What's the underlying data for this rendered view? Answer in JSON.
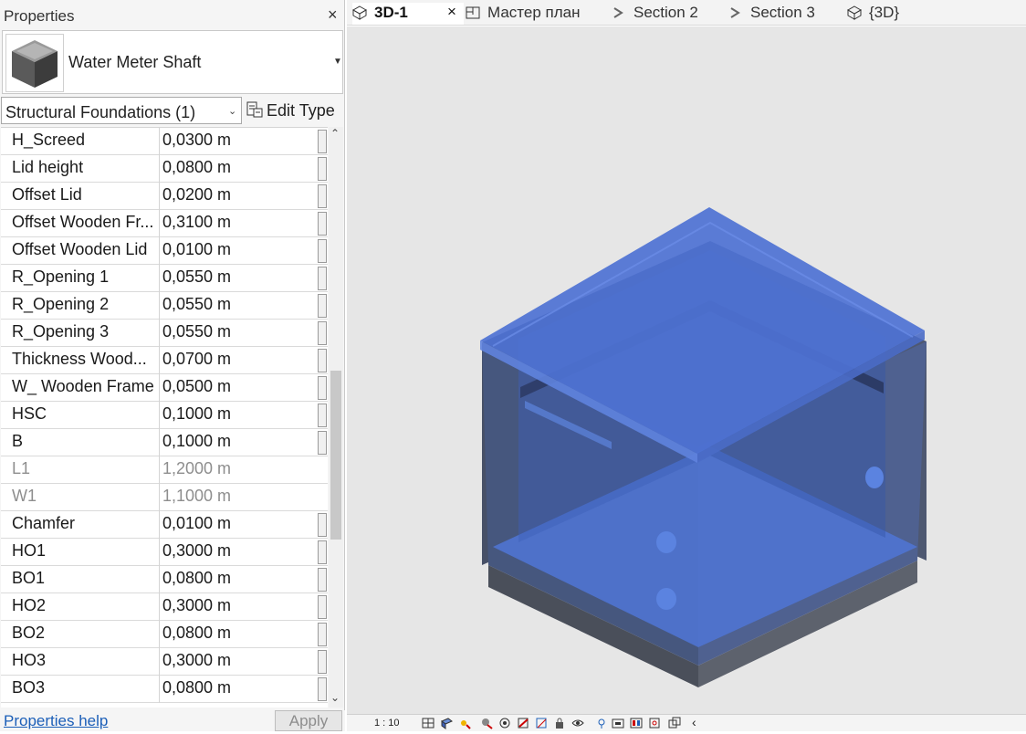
{
  "properties": {
    "title": "Properties",
    "close_glyph": "×",
    "type_name": "Water Meter Shaft",
    "filter_label": "Structural Foundations (1)",
    "edit_type_label": "Edit Type",
    "help_label": "Properties help",
    "apply_label": "Apply",
    "rows": [
      {
        "name": "H_Screed",
        "value": "0,0300 m",
        "dim": false
      },
      {
        "name": "Lid height",
        "value": "0,0800 m",
        "dim": false
      },
      {
        "name": "Offset Lid",
        "value": "0,0200 m",
        "dim": false
      },
      {
        "name": "Offset Wooden Fr...",
        "value": "0,3100 m",
        "dim": false
      },
      {
        "name": "Offset Wooden Lid",
        "value": "0,0100 m",
        "dim": false
      },
      {
        "name": "R_Opening 1",
        "value": "0,0550 m",
        "dim": false
      },
      {
        "name": "R_Opening 2",
        "value": "0,0550 m",
        "dim": false
      },
      {
        "name": "R_Opening 3",
        "value": "0,0550 m",
        "dim": false
      },
      {
        "name": "Thickness  Wood...",
        "value": "0,0700 m",
        "dim": false
      },
      {
        "name": "W_ Wooden Frame",
        "value": "0,0500 m",
        "dim": false
      },
      {
        "name": "HSC",
        "value": "0,1000 m",
        "dim": false
      },
      {
        "name": "B",
        "value": "0,1000 m",
        "dim": false
      },
      {
        "name": "L1",
        "value": "1,2000 m",
        "dim": true
      },
      {
        "name": "W1",
        "value": "1,1000 m",
        "dim": true
      },
      {
        "name": "Chamfer",
        "value": "0,0100 m",
        "dim": false
      },
      {
        "name": "HO1",
        "value": "0,3000 m",
        "dim": false
      },
      {
        "name": "BO1",
        "value": "0,0800 m",
        "dim": false
      },
      {
        "name": "HO2",
        "value": "0,3000 m",
        "dim": false
      },
      {
        "name": "BO2",
        "value": "0,0800 m",
        "dim": false
      },
      {
        "name": "HO3",
        "value": "0,3000 m",
        "dim": false
      },
      {
        "name": "BO3",
        "value": "0,0800 m",
        "dim": false
      }
    ]
  },
  "tabs": [
    {
      "label": "3D-1",
      "icon": "3d-view-icon",
      "active": true
    },
    {
      "label": "Мастер план",
      "icon": "floor-plan-icon",
      "active": false
    },
    {
      "label": "Section 2",
      "icon": "section-icon",
      "active": false
    },
    {
      "label": "Section 3",
      "icon": "section-icon",
      "active": false
    },
    {
      "label": "{3D}",
      "icon": "3d-view-icon",
      "active": false
    }
  ],
  "view_bar": {
    "scale": "1 : 10"
  },
  "colors": {
    "shaft_blue": "#3f68c8",
    "shaft_gray": "#4a4f5a",
    "viewport_bg": "#e6e6e6"
  }
}
